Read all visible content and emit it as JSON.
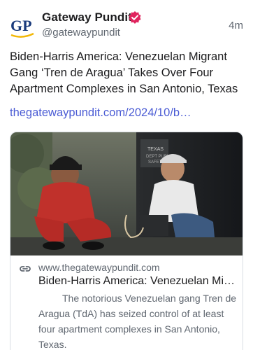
{
  "author": {
    "name": "Gateway Pundit",
    "handle": "@gatewaypundit",
    "avatar_initials": "GP",
    "verified_icon": "verified-badge-icon"
  },
  "post": {
    "time": "4m",
    "text": "Biden-Harris America: Venezuelan Migrant Gang ‘Tren de Aragua’ Takes Over Four Apartment Complexes in San Antonio, Texas",
    "link_text": "thegatewaypundit.com/2024/10/b…"
  },
  "card": {
    "link_icon": "link-icon",
    "domain": "www.thegatewaypundit.com",
    "title": "Biden-Harris America: Venezuelan Mi…",
    "description": "The notorious Venezuelan gang Tren de Aragua (TdA) has seized control of at least four apartment complexes in San Antonio, Texas.",
    "vest_text": "TEXAS"
  },
  "colors": {
    "link": "#4a5bd4",
    "verified": "#e0245e",
    "secondary_text": "#606770",
    "avatar_blue": "#1a3b7c",
    "avatar_yellow": "#f2b705"
  }
}
